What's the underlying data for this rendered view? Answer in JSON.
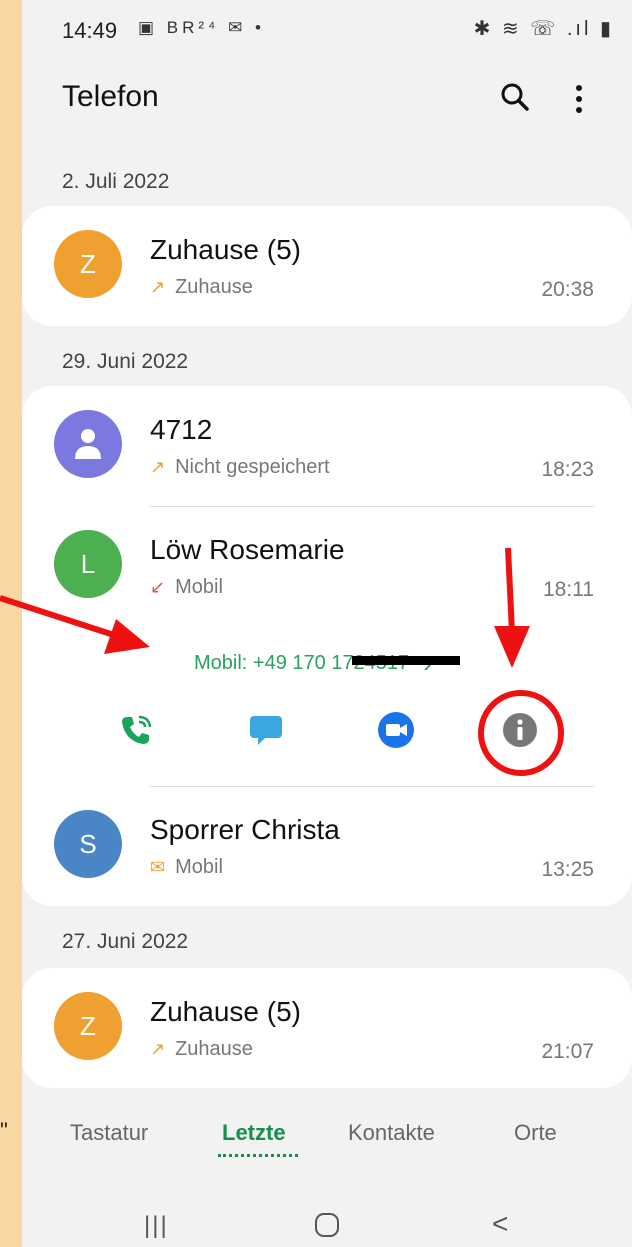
{
  "status": {
    "time": "14:49",
    "left_icons": "▣ BR²⁴ ✉ •",
    "right_icons": "✱ ≋ ☏ .ıl ▮"
  },
  "header": {
    "title": "Telefon"
  },
  "sections": [
    {
      "date": "2. Juli 2022"
    },
    {
      "date": "29. Juni 2022"
    },
    {
      "date": "27. Juni 2022"
    }
  ],
  "calls": [
    {
      "initial": "Z",
      "avatar_color": "#f0a030",
      "name": "Zuhause (5)",
      "type_icon": "outgoing-call-icon",
      "label": "Zuhause",
      "time": "20:38"
    },
    {
      "initial": "",
      "avatar_color": "#7b78e0",
      "name": "4712",
      "type_icon": "outgoing-call-icon",
      "label": "Nicht gespeichert",
      "time": "18:23"
    },
    {
      "initial": "L",
      "avatar_color": "#4caf50",
      "name": "Löw Rosemarie",
      "type_icon": "missed-call-icon",
      "label": "Mobil",
      "time": "18:11"
    },
    {
      "initial": "S",
      "avatar_color": "#4a86c5",
      "name": "Sporrer Christa",
      "type_icon": "message-outgoing-icon",
      "label": "Mobil",
      "time": "13:25"
    },
    {
      "initial": "Z",
      "avatar_color": "#f0a030",
      "name": "Zuhause (5)",
      "type_icon": "outgoing-call-icon",
      "label": "Zuhause",
      "time": "21:07"
    }
  ],
  "expanded": {
    "number_label": "Mobil: +49 170 1724517",
    "chevron": "›"
  },
  "tabs": [
    {
      "label": "Tastatur"
    },
    {
      "label": "Letzte"
    },
    {
      "label": "Kontakte"
    },
    {
      "label": "Orte"
    }
  ],
  "quote_char": "\"",
  "colors": {
    "accent": "#148f4d",
    "number_green": "#2aa15f",
    "missed": "#e05a40",
    "outgoing": "#f0a030",
    "annotation_red": "#ee1111"
  },
  "navbar": {
    "recent": "|||",
    "back": "<"
  }
}
